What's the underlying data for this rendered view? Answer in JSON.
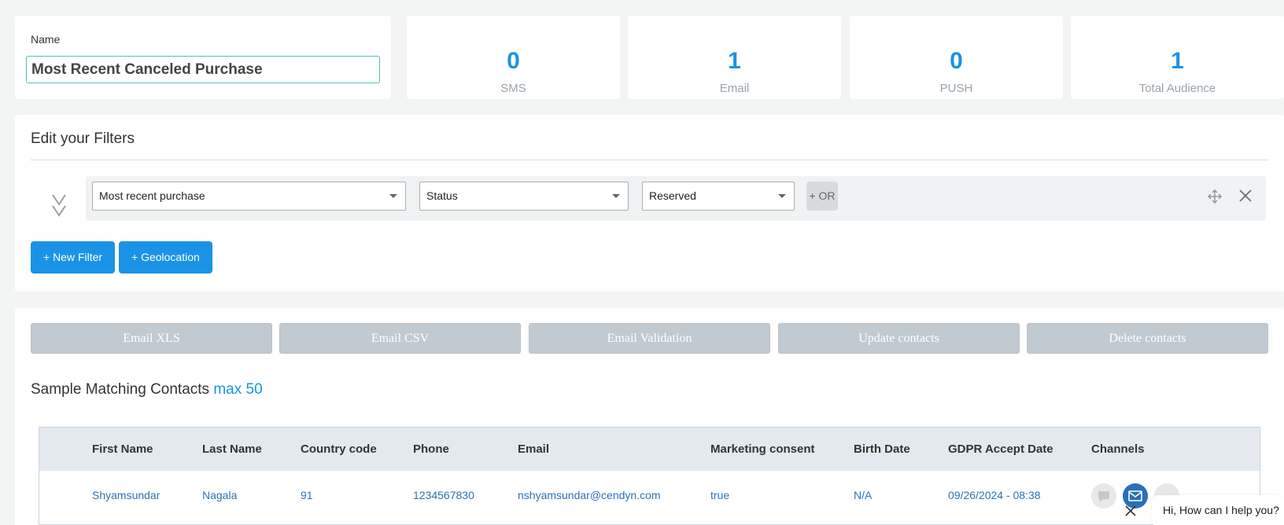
{
  "name_card": {
    "label": "Name",
    "value": "Most Recent Canceled Purchase"
  },
  "stats": [
    {
      "value": "0",
      "label": "SMS"
    },
    {
      "value": "1",
      "label": "Email"
    },
    {
      "value": "0",
      "label": "PUSH"
    },
    {
      "value": "1",
      "label": "Total Audience"
    }
  ],
  "filters": {
    "title": "Edit your Filters",
    "field": "Most recent purchase",
    "attribute": "Status",
    "value": "Reserved",
    "or_label": "+ OR",
    "new_filter_label": "+ New Filter",
    "geolocation_label": "+ Geolocation"
  },
  "actions": [
    "Email XLS",
    "Email CSV",
    "Email Validation",
    "Update contacts",
    "Delete contacts"
  ],
  "sample": {
    "title": "Sample Matching Contacts",
    "max_label": "max 50"
  },
  "table": {
    "headers": [
      "First Name",
      "Last Name",
      "Country code",
      "Phone",
      "Email",
      "Marketing consent",
      "Birth Date",
      "GDPR Accept Date",
      "Channels"
    ],
    "rows": [
      [
        "Shyamsundar",
        "Nagala",
        "91",
        "1234567830",
        "nshyamsundar@cendyn.com",
        "true",
        "N/A",
        "09/26/2024 - 08:38"
      ]
    ]
  },
  "chat": {
    "message": "Hi, How can I help you?"
  },
  "colors": {
    "accent": "#1a93e6",
    "link": "#2b73b5",
    "disabled_button": "#c1cad1"
  }
}
